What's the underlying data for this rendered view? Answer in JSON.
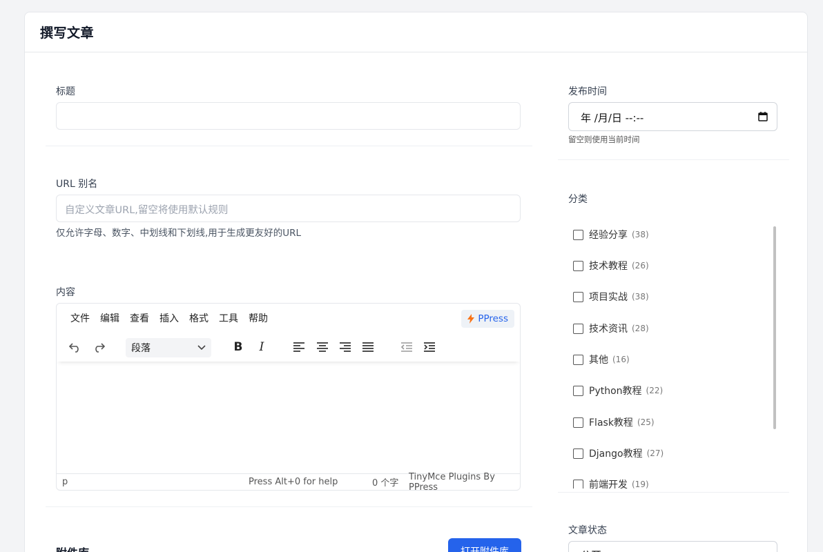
{
  "page": {
    "title": "撰写文章"
  },
  "form": {
    "title_label": "标题",
    "title_value": "",
    "slug_label": "URL 别名",
    "slug_placeholder": "自定义文章URL,留空将使用默认规则",
    "slug_help": "仅允许字母、数字、中划线和下划线,用于生成更友好的URL",
    "content_label": "内容",
    "attachments_label": "附件库",
    "open_attachments_button": "打开附件库"
  },
  "editor": {
    "menu": [
      "文件",
      "编辑",
      "查看",
      "插入",
      "格式",
      "工具",
      "帮助"
    ],
    "ppress_label": "PPress",
    "block_format": "段落",
    "status_path": "p",
    "status_help": "Press Alt+0 for help",
    "status_wordcount": "0 个字",
    "status_brand": "TinyMce Plugins By PPress",
    "icons": [
      "undo-icon",
      "redo-icon",
      "bold-icon",
      "italic-icon",
      "align-left-icon",
      "align-center-icon",
      "align-right-icon",
      "align-justify-icon",
      "outdent-icon",
      "indent-icon"
    ]
  },
  "sidebar": {
    "publish_time_label": "发布时间",
    "publish_time_value": "年 /月/日 --:--",
    "publish_time_help": "留空则使用当前时间",
    "category_label": "分类",
    "categories": [
      {
        "name": "经验分享",
        "count": "(38)"
      },
      {
        "name": "技术教程",
        "count": "(26)"
      },
      {
        "name": "项目实战",
        "count": "(38)"
      },
      {
        "name": "技术资讯",
        "count": "(28)"
      },
      {
        "name": "其他",
        "count": "(16)"
      },
      {
        "name": "Python教程",
        "count": "(22)"
      },
      {
        "name": "Flask教程",
        "count": "(25)"
      },
      {
        "name": "Django教程",
        "count": "(27)"
      },
      {
        "name": "前端开发",
        "count": "(19)"
      }
    ],
    "status_label": "文章状态",
    "status_value": "公开"
  },
  "colors": {
    "primary": "#2563eb",
    "border": "#e5e7eb",
    "background": "#f3f4f6"
  }
}
